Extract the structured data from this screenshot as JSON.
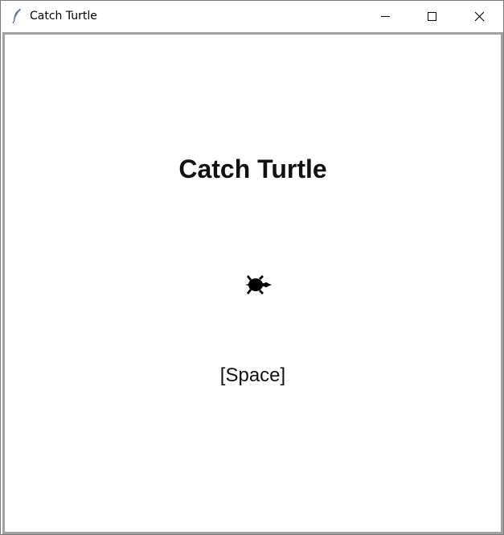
{
  "window": {
    "title": "Catch Turtle",
    "icon": "feather-icon",
    "controls": {
      "minimize": "minimize-icon",
      "maximize": "maximize-icon",
      "close": "close-icon"
    }
  },
  "game": {
    "title": "Catch Turtle",
    "prompt": "[Space]",
    "sprite": "turtle-icon",
    "sprite_color": "#000000",
    "background_color": "#ffffff"
  }
}
